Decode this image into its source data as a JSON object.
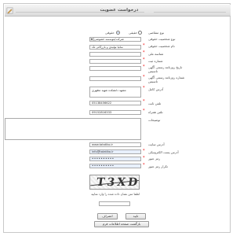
{
  "title": "درخواست عضويت",
  "form": {
    "membership_type_label": "نوع متقاضی",
    "membership_options": [
      "حقیقی",
      "حقوقی"
    ],
    "membership_selected": "حقوقی",
    "legal_type_label": "نوع شخصیت حقوقی",
    "legal_type_value": "شرکت/موسسه خصوصی",
    "legal_name_label": "نام شخصیت حقوقی",
    "legal_name_value": "ساتیا تولیدی و بازرگانی تک",
    "national_id_label": "شناسه ملی",
    "national_id_value": "",
    "reg_number_label": "شماره ثبت",
    "reg_number_value": "",
    "gazette_date_label": "تاریخ روزنامه رسمی آگهی تاسیس",
    "gazette_date_value": "",
    "gazette_number_label": "شماره روزنامه رسمی آگهی تاسیس",
    "gazette_number_value": "",
    "address_label": "آدرس کامل",
    "address_value": "مشهد دانشکده شهید مطهری",
    "phone_label": "تلفن ثابت",
    "phone_value": "05138456622",
    "mobile_label": "تلفن همراه",
    "mobile_value": "09152816333",
    "description_label": "توضیحات",
    "description_value": "",
    "website_label": "آدرس سایت",
    "website_value": "www.tatatiko.ir",
    "email_label": "آدرس پست الکترونیکی",
    "email_value": "info@tatatiko.ir",
    "password_label": "رمز عبور",
    "password_value": "••••••••••",
    "confirm_label": "تکرار رمز عبور",
    "confirm_value": "••••••••••"
  },
  "captcha": {
    "image_text": "T3XD",
    "hint": "لطفا متن نشان داده شده را وارد نمایید",
    "input_value": ""
  },
  "buttons": {
    "submit": "تایید",
    "back": "انصراف",
    "back_to_info": "بازگشت صفحه اطلاعات فرم"
  },
  "colors": {
    "required": "#e00000",
    "radio_selected": "#2a6bd1",
    "autofill": "#e8f0fe"
  }
}
